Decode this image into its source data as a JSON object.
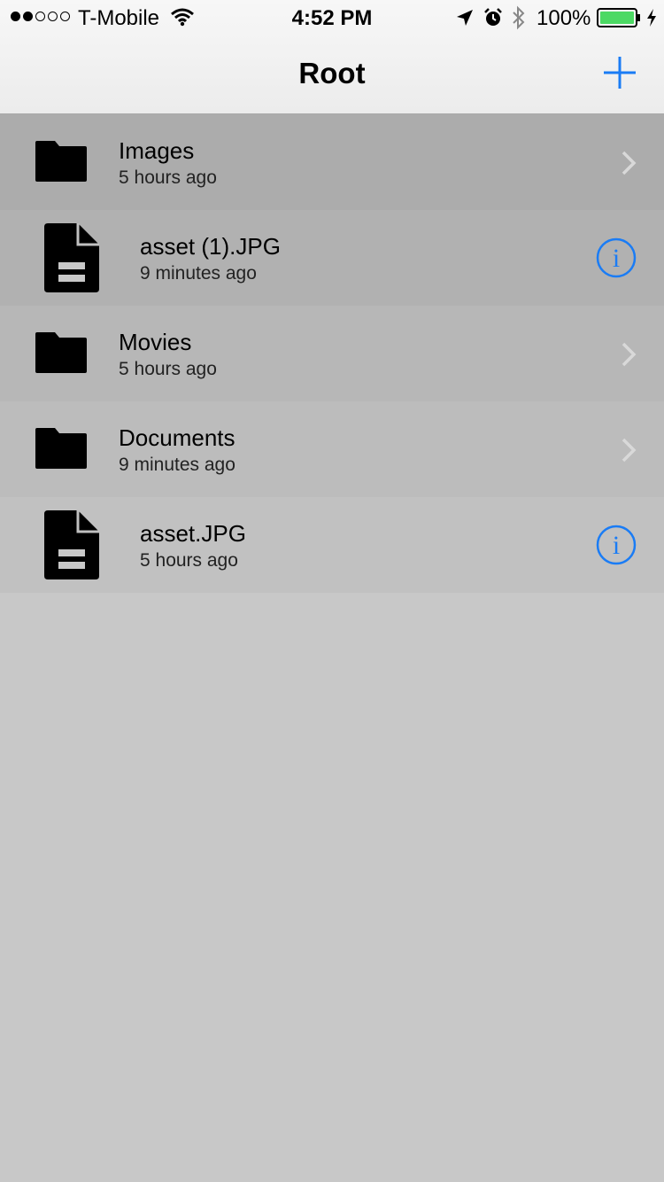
{
  "status_bar": {
    "signal_bars_filled": 2,
    "signal_bars_total": 5,
    "carrier": "T-Mobile",
    "time": "4:52 PM",
    "battery_percent": "100%",
    "battery_level": 1.0,
    "icons": [
      "wifi-icon",
      "location-arrow-icon",
      "alarm-icon",
      "bluetooth-icon",
      "battery-icon",
      "charging-bolt-icon"
    ]
  },
  "nav": {
    "title": "Root",
    "add_icon": "plus-icon"
  },
  "colors": {
    "accent": "#1a7cf5",
    "background": "#c8c8c8"
  },
  "items": [
    {
      "type": "folder",
      "name": "Images",
      "modified": "5 hours ago",
      "bg": "#acacac"
    },
    {
      "type": "file",
      "name": "asset (1).JPG",
      "modified": "9 minutes ago",
      "bg": "#b1b1b1"
    },
    {
      "type": "folder",
      "name": "Movies",
      "modified": "5 hours ago",
      "bg": "#b7b7b7"
    },
    {
      "type": "folder",
      "name": "Documents",
      "modified": "9 minutes ago",
      "bg": "#bcbcbc"
    },
    {
      "type": "file",
      "name": "asset.JPG",
      "modified": "5 hours ago",
      "bg": "#c1c1c1"
    }
  ]
}
